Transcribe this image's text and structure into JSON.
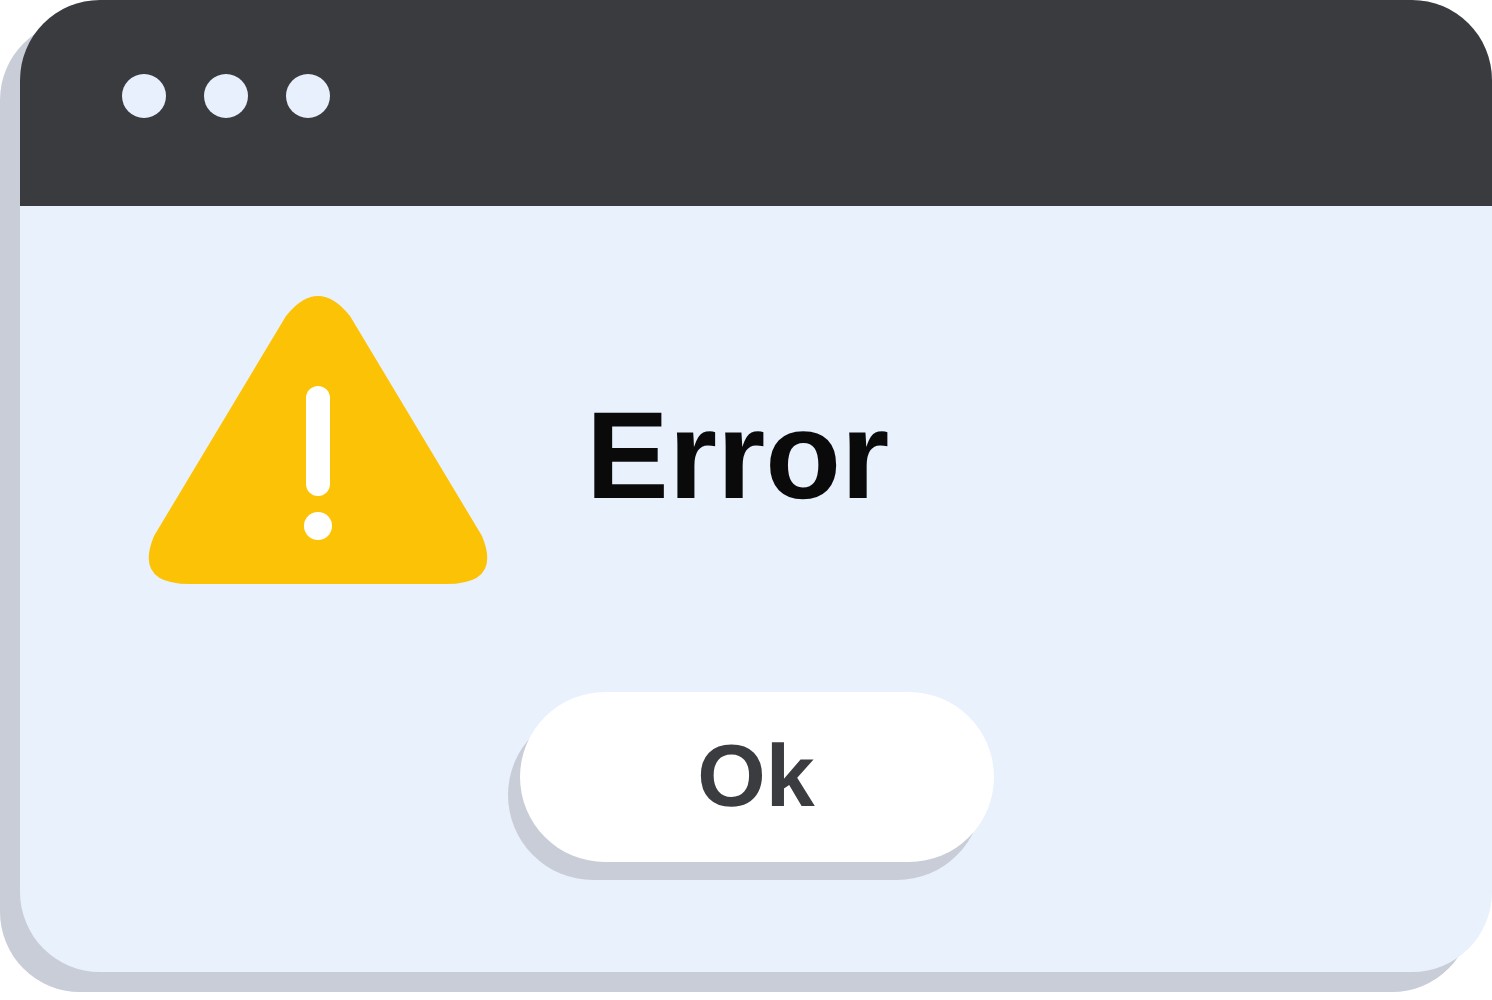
{
  "dialog": {
    "message": "Error"
  },
  "buttons": [
    {
      "label": "Ok"
    }
  ]
}
